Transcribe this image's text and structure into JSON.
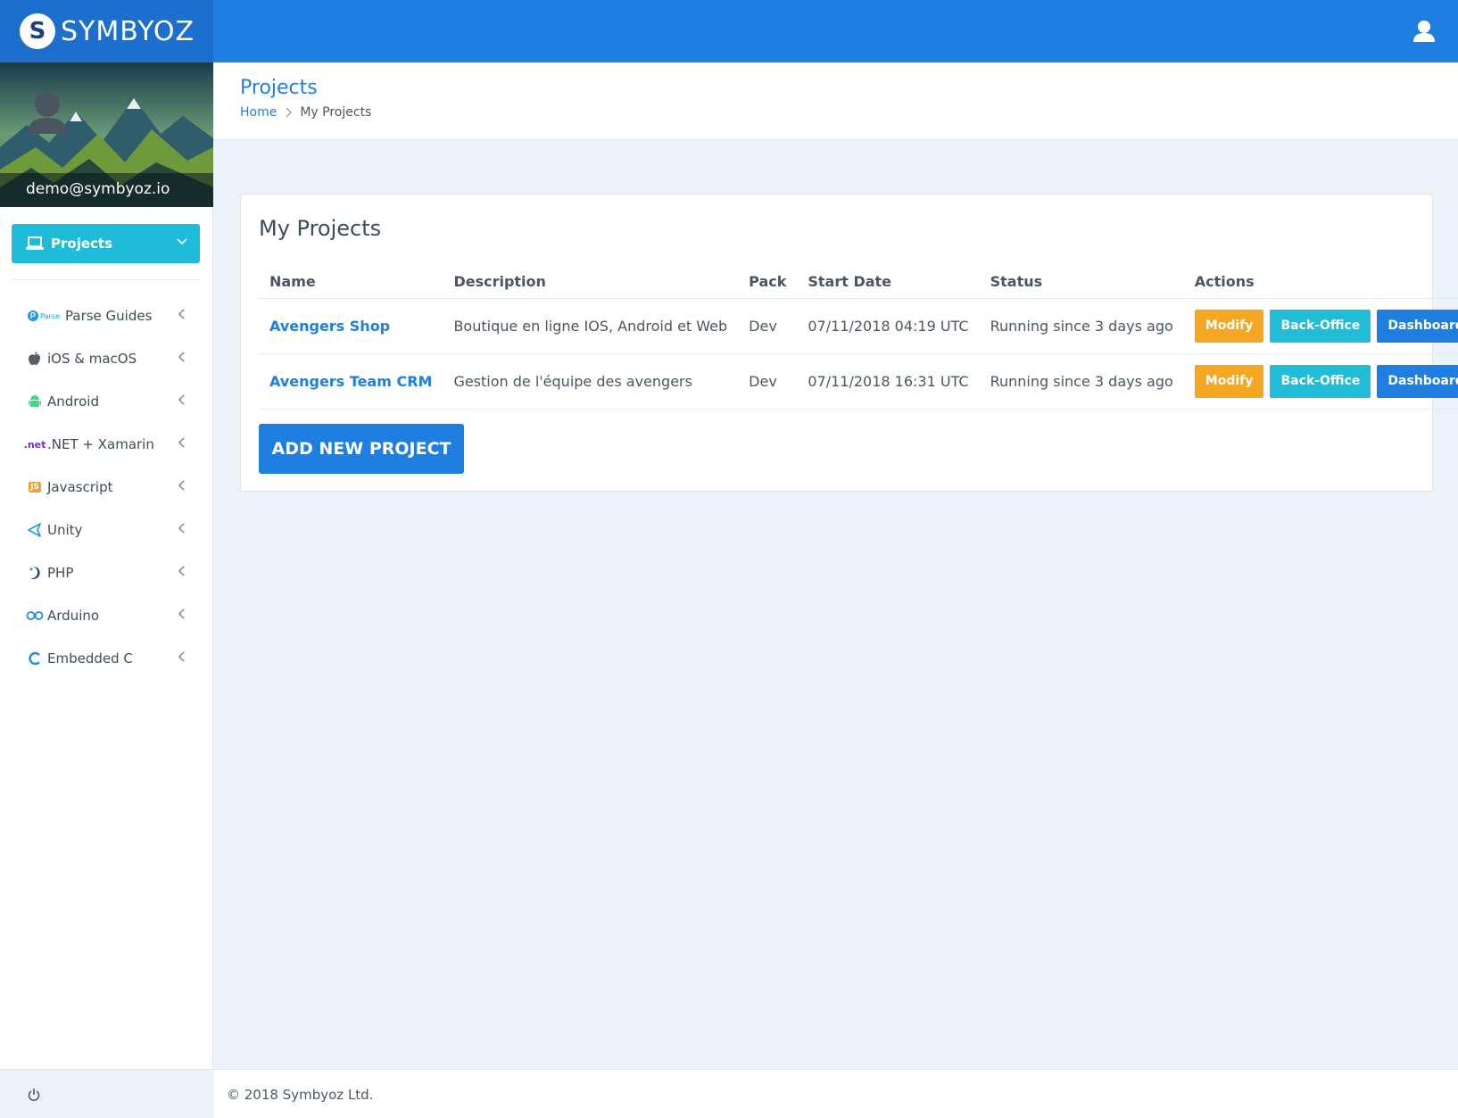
{
  "brand": {
    "logo_letter": "S",
    "name": "SYMBYOZ"
  },
  "user": {
    "email": "demo@symbyoz.io"
  },
  "sidebar": {
    "active": {
      "label": "Projects"
    },
    "items": [
      {
        "label": "Parse Guides",
        "icon": "parse-icon",
        "prefix": "Parse"
      },
      {
        "label": "iOS & macOS",
        "icon": "apple-icon"
      },
      {
        "label": "Android",
        "icon": "android-icon"
      },
      {
        "label": ".NET + Xamarin",
        "icon": "dotnet-icon",
        "prefix": ".net"
      },
      {
        "label": "Javascript",
        "icon": "javascript-icon",
        "prefix": "JS"
      },
      {
        "label": "Unity",
        "icon": "unity-icon"
      },
      {
        "label": "PHP",
        "icon": "php-icon"
      },
      {
        "label": "Arduino",
        "icon": "arduino-icon"
      },
      {
        "label": "Embedded C",
        "icon": "c-icon"
      }
    ]
  },
  "header": {
    "title": "Projects",
    "breadcrumb": {
      "home": "Home",
      "current": "My Projects"
    }
  },
  "projects": {
    "title": "My Projects",
    "columns": [
      "Name",
      "Description",
      "Pack",
      "Start Date",
      "Status",
      "Actions"
    ],
    "rows": [
      {
        "name": "Avengers Shop",
        "description": "Boutique en ligne IOS, Android et Web",
        "pack": "Dev",
        "start_date": "07/11/2018 04:19 UTC",
        "status": "Running since 3 days ago"
      },
      {
        "name": "Avengers Team CRM",
        "description": "Gestion de l'équipe des avengers",
        "pack": "Dev",
        "start_date": "07/11/2018 16:31 UTC",
        "status": "Running since 3 days ago"
      }
    ],
    "actions": {
      "modify": "Modify",
      "backoffice": "Back-Office",
      "dashboard": "Dashboard"
    },
    "add_button": "ADD NEW PROJECT"
  },
  "footer": {
    "text": "© 2018 Symbyoz Ltd."
  },
  "colors": {
    "primary": "#1e7fe0",
    "cyan": "#1ebcd9",
    "orange": "#f5a623",
    "background": "#ecf2f9"
  }
}
